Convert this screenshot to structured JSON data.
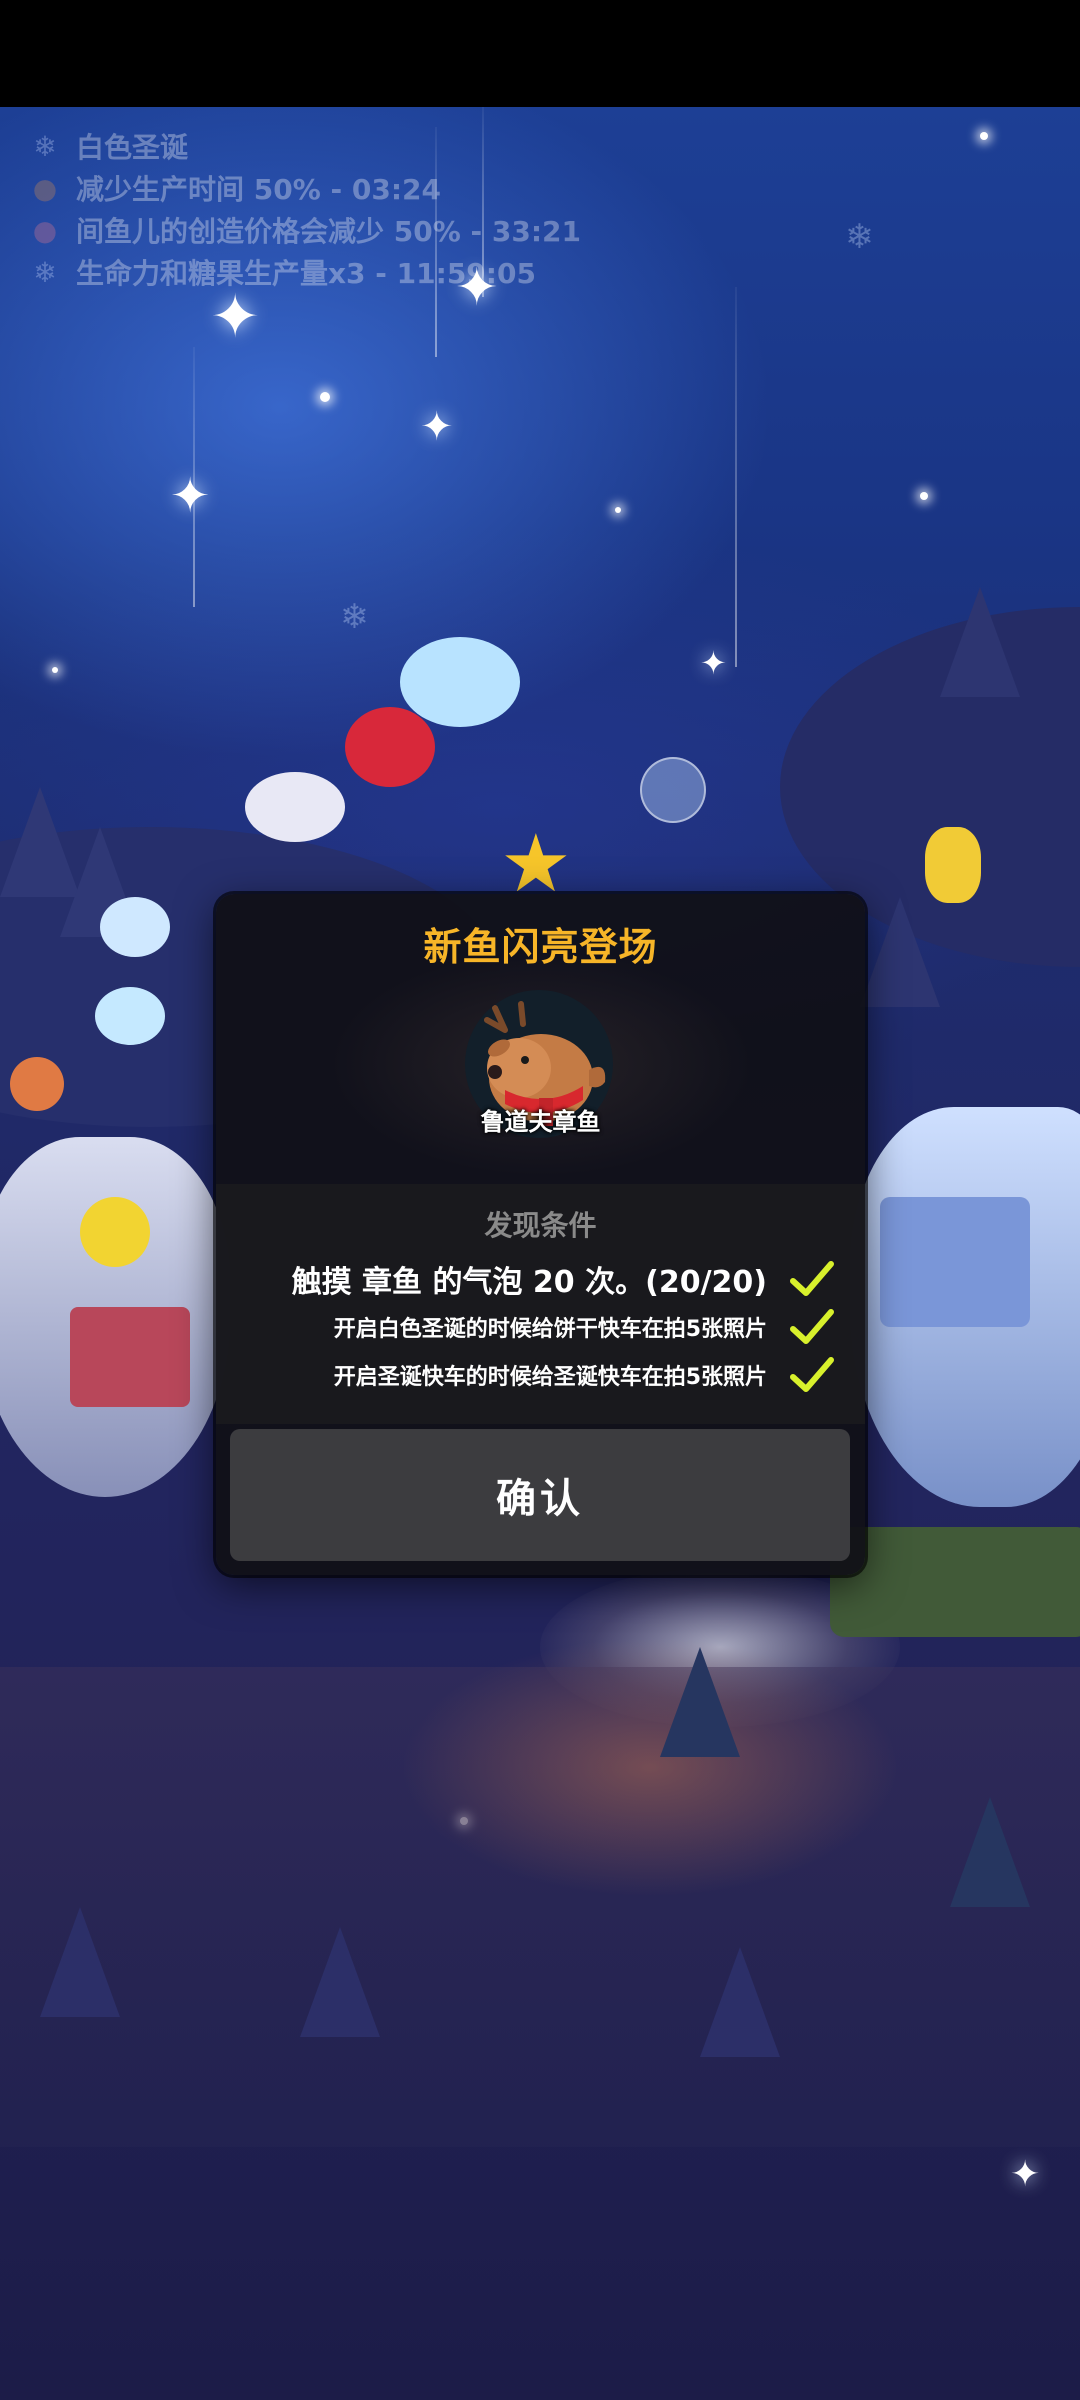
{
  "buffs": [
    {
      "icon": "snowflake-icon",
      "text": "白色圣诞"
    },
    {
      "icon": "reindeer-icon",
      "text": "减少生产时间 50% - 03:24"
    },
    {
      "icon": "fish-icon",
      "text": "间鱼儿的创造价格会减少 50% - 33:21"
    },
    {
      "icon": "snowflake-icon",
      "text": "生命力和糖果生产量x3 - 11:59:05"
    }
  ],
  "dialog": {
    "title": "新鱼闪亮登场",
    "fish_name": "鲁道夫章鱼",
    "conditions_title": "发现条件",
    "conditions": [
      {
        "text": "触摸 章鱼 的气泡 20 次。(20/20)",
        "done": true
      },
      {
        "text": "开启白色圣诞的时候给饼干快车在拍5张照片",
        "done": true
      },
      {
        "text": "开启圣诞快车的时候给圣诞快车在拍5张照片",
        "done": true
      }
    ],
    "confirm_label": "确认"
  },
  "colors": {
    "title_accent": "#f7b528",
    "check": "#d8f02c",
    "button": "#3c3c3f"
  }
}
